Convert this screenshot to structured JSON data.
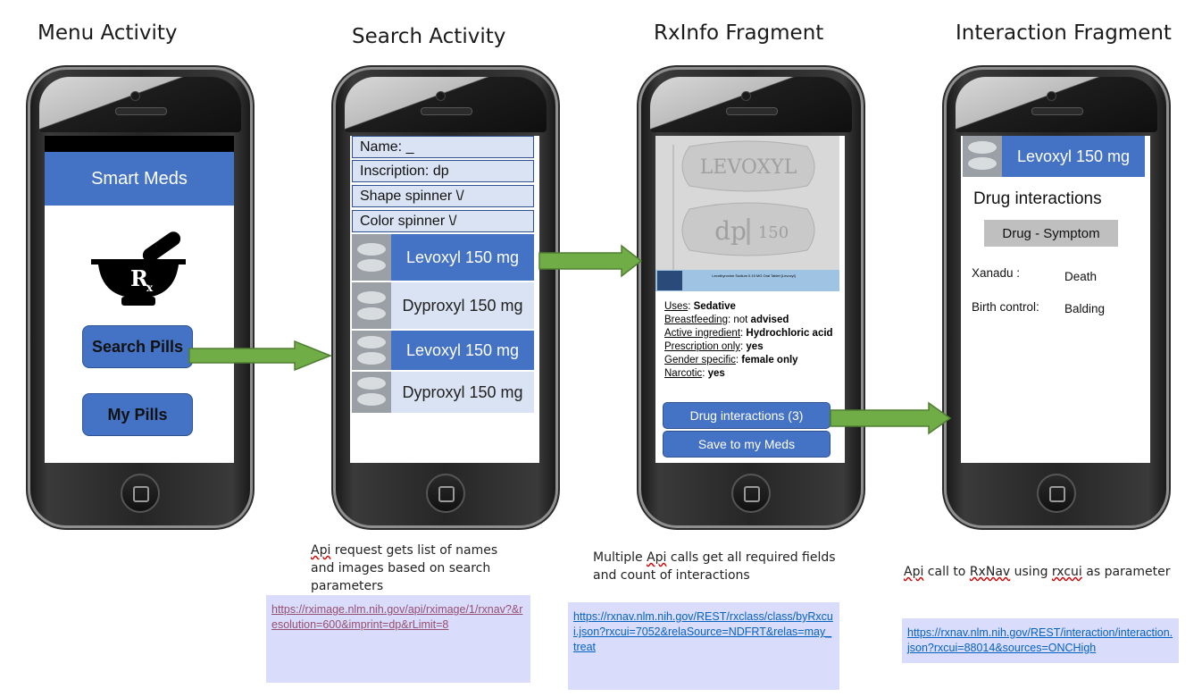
{
  "titles": {
    "menu": "Menu Activity",
    "search": "Search Activity",
    "rxinfo": "RxInfo Fragment",
    "interaction": "Interaction Fragment"
  },
  "phone1": {
    "app_title": "Smart Meds",
    "logo": "mortar-pestle-rx-icon",
    "search_button": "Search Pills",
    "mypills_button": "My Pills"
  },
  "phone2": {
    "name_field": "Name: _",
    "inscription_field": "Inscription: dp",
    "shape_spinner": "Shape spinner \\/",
    "color_spinner": "Color spinner \\/",
    "results": [
      {
        "label": "Levoxyl 150 mg"
      },
      {
        "label": "Dyproxyl 150 mg"
      },
      {
        "label": "Levoxyl 150 mg"
      },
      {
        "label": "Dyproxyl 150 mg"
      }
    ]
  },
  "phone3": {
    "imprint_top": "LEVOXYL",
    "imprint_left": "dp",
    "imprint_right": "150",
    "caption": "Levothyroxine Sodium 0.15 MG Oral Tablet [Levoxyl]",
    "info": [
      {
        "key": "Uses",
        "sep": ": ",
        "pre": "",
        "value": "Sedative"
      },
      {
        "key": "Breastfeeding",
        "sep": ": ",
        "pre": "not ",
        "value": "advised"
      },
      {
        "key": "Active ingredient",
        "sep": ": ",
        "pre": "",
        "value": "Hydrochloric acid"
      },
      {
        "key": "Prescription only",
        "sep": ": ",
        "pre": "",
        "value": "yes"
      },
      {
        "key": "Gender specific",
        "sep": ": ",
        "pre": "",
        "value": "female only"
      },
      {
        "key": "Narcotic",
        "sep": ": ",
        "pre": "",
        "value": "yes"
      }
    ],
    "interactions_button": "Drug interactions (3)",
    "save_button": "Save to my Meds"
  },
  "phone4": {
    "header": "Levoxyl 150 mg",
    "title": "Drug interactions",
    "table_header": "Drug   - Symptom",
    "rows": [
      {
        "drug": "Xanadu :",
        "symptom": "Death"
      },
      {
        "drug": "Birth control:",
        "symptom": "Balding"
      }
    ]
  },
  "notes": {
    "search": {
      "w1": "Api",
      "l1": " request gets list of names",
      "l2": "and images based on search",
      "l3": "parameters",
      "url": "https://rximage.nlm.nih.gov/api/rximage/1/rxnav?&resolution=600&imprint=dp&rLimit=8"
    },
    "rxinfo": {
      "l1a": "Multiple ",
      "w1": "Api",
      "l1b": " calls get all required fields",
      "l2": "and count of interactions",
      "url": "https://rxnav.nlm.nih.gov/REST/rxclass/class/byRxcui.json?rxcui=7052&relaSource=NDFRT&relas=may_treat"
    },
    "interaction": {
      "w1": "Api",
      "t1": " call to ",
      "w2": "RxNav",
      "t2": " using ",
      "w3": "rxcui",
      "t3": " as parameter",
      "url": "https://rxnav.nlm.nih.gov/REST/interaction/interaction.json?rxcui=88014&sources=ONCHigh"
    }
  },
  "colors": {
    "accent_blue": "#4472c4",
    "light_blue": "#dae3f3",
    "arrow_green": "#70ad47",
    "url_box_bg": "#dadcfb",
    "link_visited": "#954f72",
    "link": "#0563c1"
  }
}
